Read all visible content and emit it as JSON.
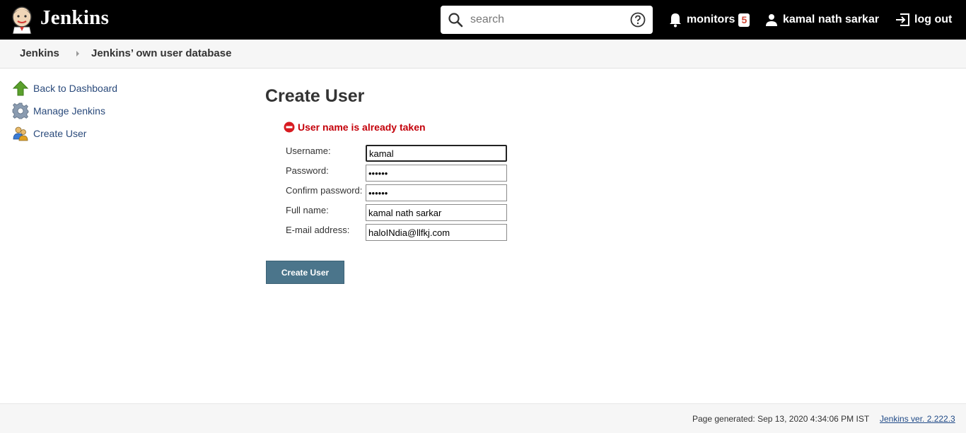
{
  "header": {
    "brand": "Jenkins",
    "search": {
      "placeholder": "search",
      "value": ""
    },
    "monitors_label": "monitors",
    "monitors_count": "5",
    "user_name": "kamal nath sarkar",
    "logout_label": "log out"
  },
  "breadcrumb": {
    "items": [
      "Jenkins",
      "Jenkins’ own user database"
    ]
  },
  "sidebar": {
    "items": [
      {
        "label": "Back to Dashboard",
        "icon": "up-arrow-icon"
      },
      {
        "label": "Manage Jenkins",
        "icon": "gear-icon"
      },
      {
        "label": "Create User",
        "icon": "users-icon"
      }
    ]
  },
  "main": {
    "title": "Create User",
    "error": "User name is already taken",
    "fields": [
      {
        "label": "Username:",
        "value": "kamal"
      },
      {
        "label": "Password:",
        "value": "••••••"
      },
      {
        "label": "Confirm password:",
        "value": "••••••"
      },
      {
        "label": "Full name:",
        "value": "kamal nath sarkar"
      },
      {
        "label": "E-mail address:",
        "value": "haloINdia@llfkj.com"
      }
    ],
    "submit_label": "Create User"
  },
  "footer": {
    "generated": "Page generated: Sep 13, 2020 4:34:06 PM IST",
    "version": "Jenkins ver. 2.222.3"
  },
  "colors": {
    "header_bg": "#000000",
    "error": "#c4000a",
    "button": "#4b758b",
    "link": "#204a87"
  }
}
